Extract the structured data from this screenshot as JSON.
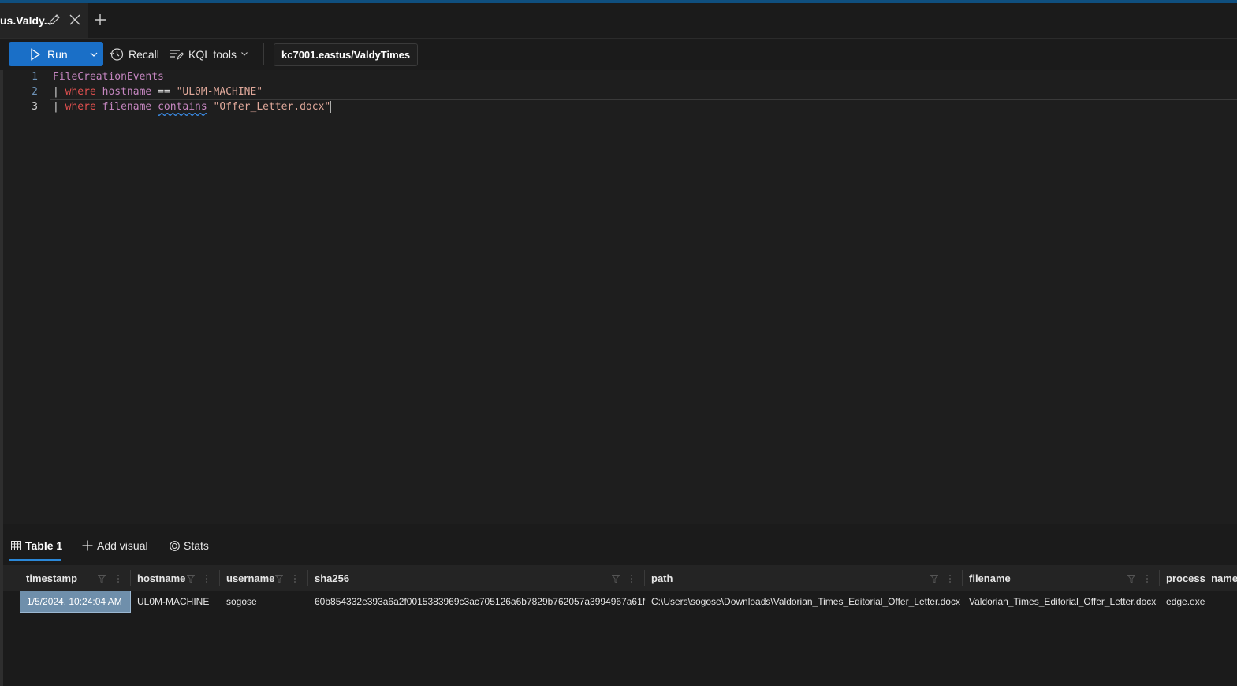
{
  "tab": {
    "title": "us.Valdy..."
  },
  "toolbar": {
    "run_label": "Run",
    "recall_label": "Recall",
    "kql_tools_label": "KQL tools",
    "cluster": "kc7001.eastus/ValdyTimes"
  },
  "editor": {
    "lines": [
      {
        "number": "1",
        "table": "FileCreationEvents"
      },
      {
        "number": "2",
        "pipe": "|",
        "kw": "where",
        "col": "hostname",
        "op": "==",
        "str": "\"UL0M-MACHINE\""
      },
      {
        "number": "3",
        "pipe": "|",
        "kw": "where",
        "col": "filename",
        "fn": "contains",
        "str": "\"Offer_Letter.docx\""
      }
    ]
  },
  "results": {
    "tabs": {
      "table": "Table 1",
      "add_visual": "Add visual",
      "stats": "Stats"
    },
    "columns": [
      "timestamp",
      "hostname",
      "username",
      "sha256",
      "path",
      "filename",
      "process_name"
    ],
    "rows": [
      {
        "timestamp": "1/5/2024, 10:24:04 AM",
        "hostname": "UL0M-MACHINE",
        "username": "sogose",
        "sha256": "60b854332e393a6a2f0015383969c3ac705126a6b7829b762057a3994967a61f",
        "path": "C:\\Users\\sogose\\Downloads\\Valdorian_Times_Editorial_Offer_Letter.docx",
        "filename": "Valdorian_Times_Editorial_Offer_Letter.docx",
        "process_name": "edge.exe"
      }
    ]
  },
  "colors": {
    "accent": "#1a6fc7",
    "selected_cell": "#6f8fab"
  }
}
